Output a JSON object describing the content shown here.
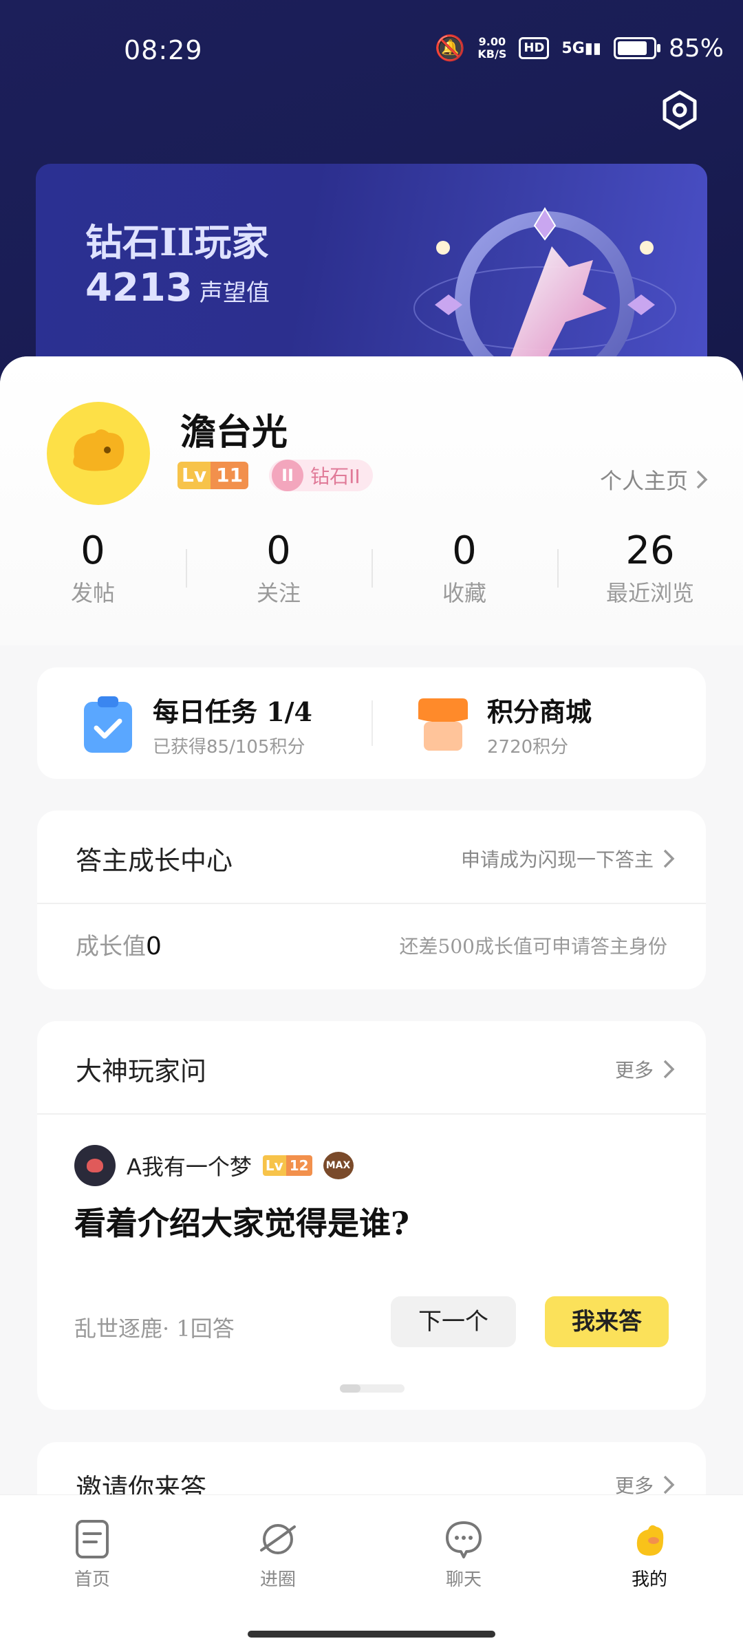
{
  "status_bar": {
    "time": "08:29",
    "net_speed_top": "9.00",
    "net_speed_unit": "KB/S",
    "hd": "HD",
    "signal": "5G",
    "battery": "85%"
  },
  "rank": {
    "title": "钻石II玩家",
    "score": "4213",
    "score_unit": "声望值"
  },
  "profile": {
    "username": "澹台光",
    "lv_prefix": "Lv",
    "level": "11",
    "rank_badge": "钻石II",
    "rank_badge_icon": "II",
    "homepage_link": "个人主页"
  },
  "stats": [
    {
      "value": "0",
      "label": "发帖"
    },
    {
      "value": "0",
      "label": "关注"
    },
    {
      "value": "0",
      "label": "收藏"
    },
    {
      "value": "26",
      "label": "最近浏览"
    }
  ],
  "tasks": {
    "daily": {
      "title": "每日任务 1/4",
      "subtitle": "已获得85/105积分"
    },
    "mall": {
      "title": "积分商城",
      "subtitle": "2720积分"
    }
  },
  "growth": {
    "title": "答主成长中心",
    "link": "申请成为闪现一下答主",
    "label": "成长值",
    "value": "0",
    "hint": "还差500成长值可申请答主身份"
  },
  "qa": {
    "title": "大神玩家问",
    "more": "更多",
    "asker": {
      "name": "A我有一个梦",
      "lv_prefix": "Lv",
      "level": "12",
      "badge": "MAX"
    },
    "question": "看着介绍大家觉得是谁?",
    "meta": "乱世逐鹿· 1回答",
    "next_button": "下一个",
    "answer_button": "我来答"
  },
  "invite": {
    "title": "邀请你来答",
    "more": "更多"
  },
  "nav": [
    {
      "label": "首页",
      "icon": "home-doc-icon"
    },
    {
      "label": "进圈",
      "icon": "planet-icon"
    },
    {
      "label": "聊天",
      "icon": "chat-bubble-icon"
    },
    {
      "label": "我的",
      "icon": "duck-mascot-icon",
      "active": true
    }
  ],
  "colors": {
    "accent_yellow": "#fbe15a",
    "header_navy": "#1c1f5a",
    "level_orange": "#f2904c"
  }
}
